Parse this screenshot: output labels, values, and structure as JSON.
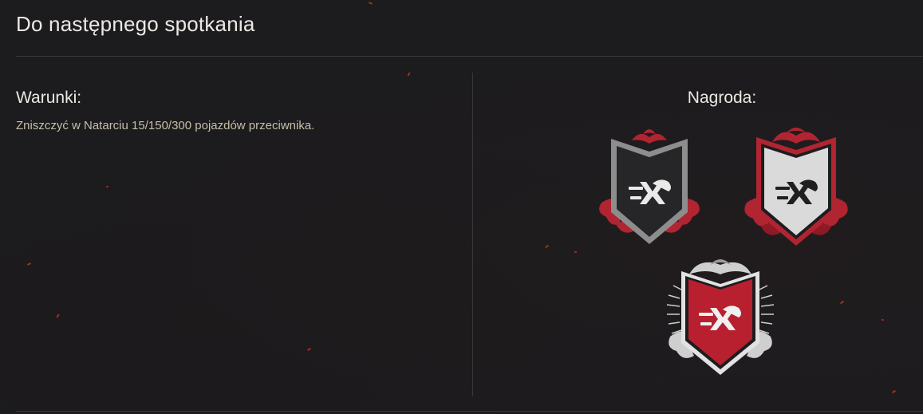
{
  "header": {
    "title": "Do następnego spotkania"
  },
  "conditions": {
    "label": "Warunki:",
    "text": "Zniszczyć w Natarciu 15/150/300 pojazdów przeciwnika."
  },
  "reward": {
    "label": "Nagroda:",
    "medals": [
      {
        "name": "bronze-tier-badge",
        "shield_color": "#2a2a2a",
        "border_color": "#8d8d8d"
      },
      {
        "name": "silver-tier-badge",
        "shield_color": "#d9d9d9",
        "border_color": "#b12431"
      },
      {
        "name": "gold-tier-badge",
        "shield_color": "#b8202f",
        "border_color": "#d8d8d8"
      }
    ]
  },
  "colors": {
    "background": "#1c1b1e",
    "accent_red": "#b8202f",
    "text_muted": "#c6bfa8",
    "divider": "#3d3b3f"
  }
}
